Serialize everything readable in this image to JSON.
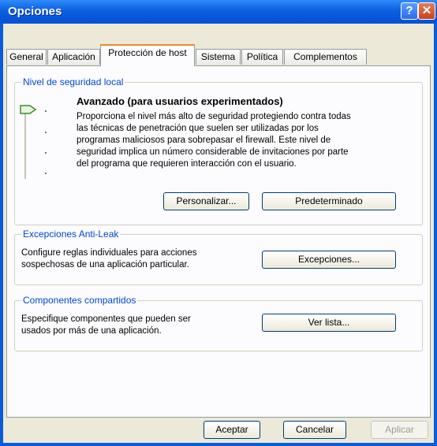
{
  "window": {
    "title": "Opciones",
    "help_label": "?",
    "close_label": "✕"
  },
  "tabs": [
    "General",
    "Aplicación",
    "Protección de host",
    "Sistema",
    "Política",
    "Complementos"
  ],
  "local_security": {
    "legend": "Nivel de seguridad local",
    "level_title": "Avanzado (para usuarios experimentados)",
    "description": [
      "Proporciona el nivel más alto de seguridad protegiendo contra todas",
      "las técnicas de penetración que suelen ser utilizadas por los",
      "programas maliciosos para sobrepasar el firewall. Este nivel de",
      "seguridad implica un número considerable de invitaciones por parte",
      "del programa que requieren interacción con el usuario."
    ],
    "customize_label": "Personalizar...",
    "default_label": "Predeterminado"
  },
  "antileak": {
    "legend": "Excepciones Anti-Leak",
    "description": [
      "Configure reglas individuales para acciones",
      "sospechosas de una aplicación particular."
    ],
    "button_label": "Excepciones..."
  },
  "shared": {
    "legend": "Componentes compartidos",
    "description": [
      "Especifique componentes que pueden ser",
      "usados por más de una aplicación."
    ],
    "button_label": "Ver lista..."
  },
  "footer": {
    "ok_label": "Aceptar",
    "cancel_label": "Cancelar",
    "apply_label": "Aplicar"
  }
}
